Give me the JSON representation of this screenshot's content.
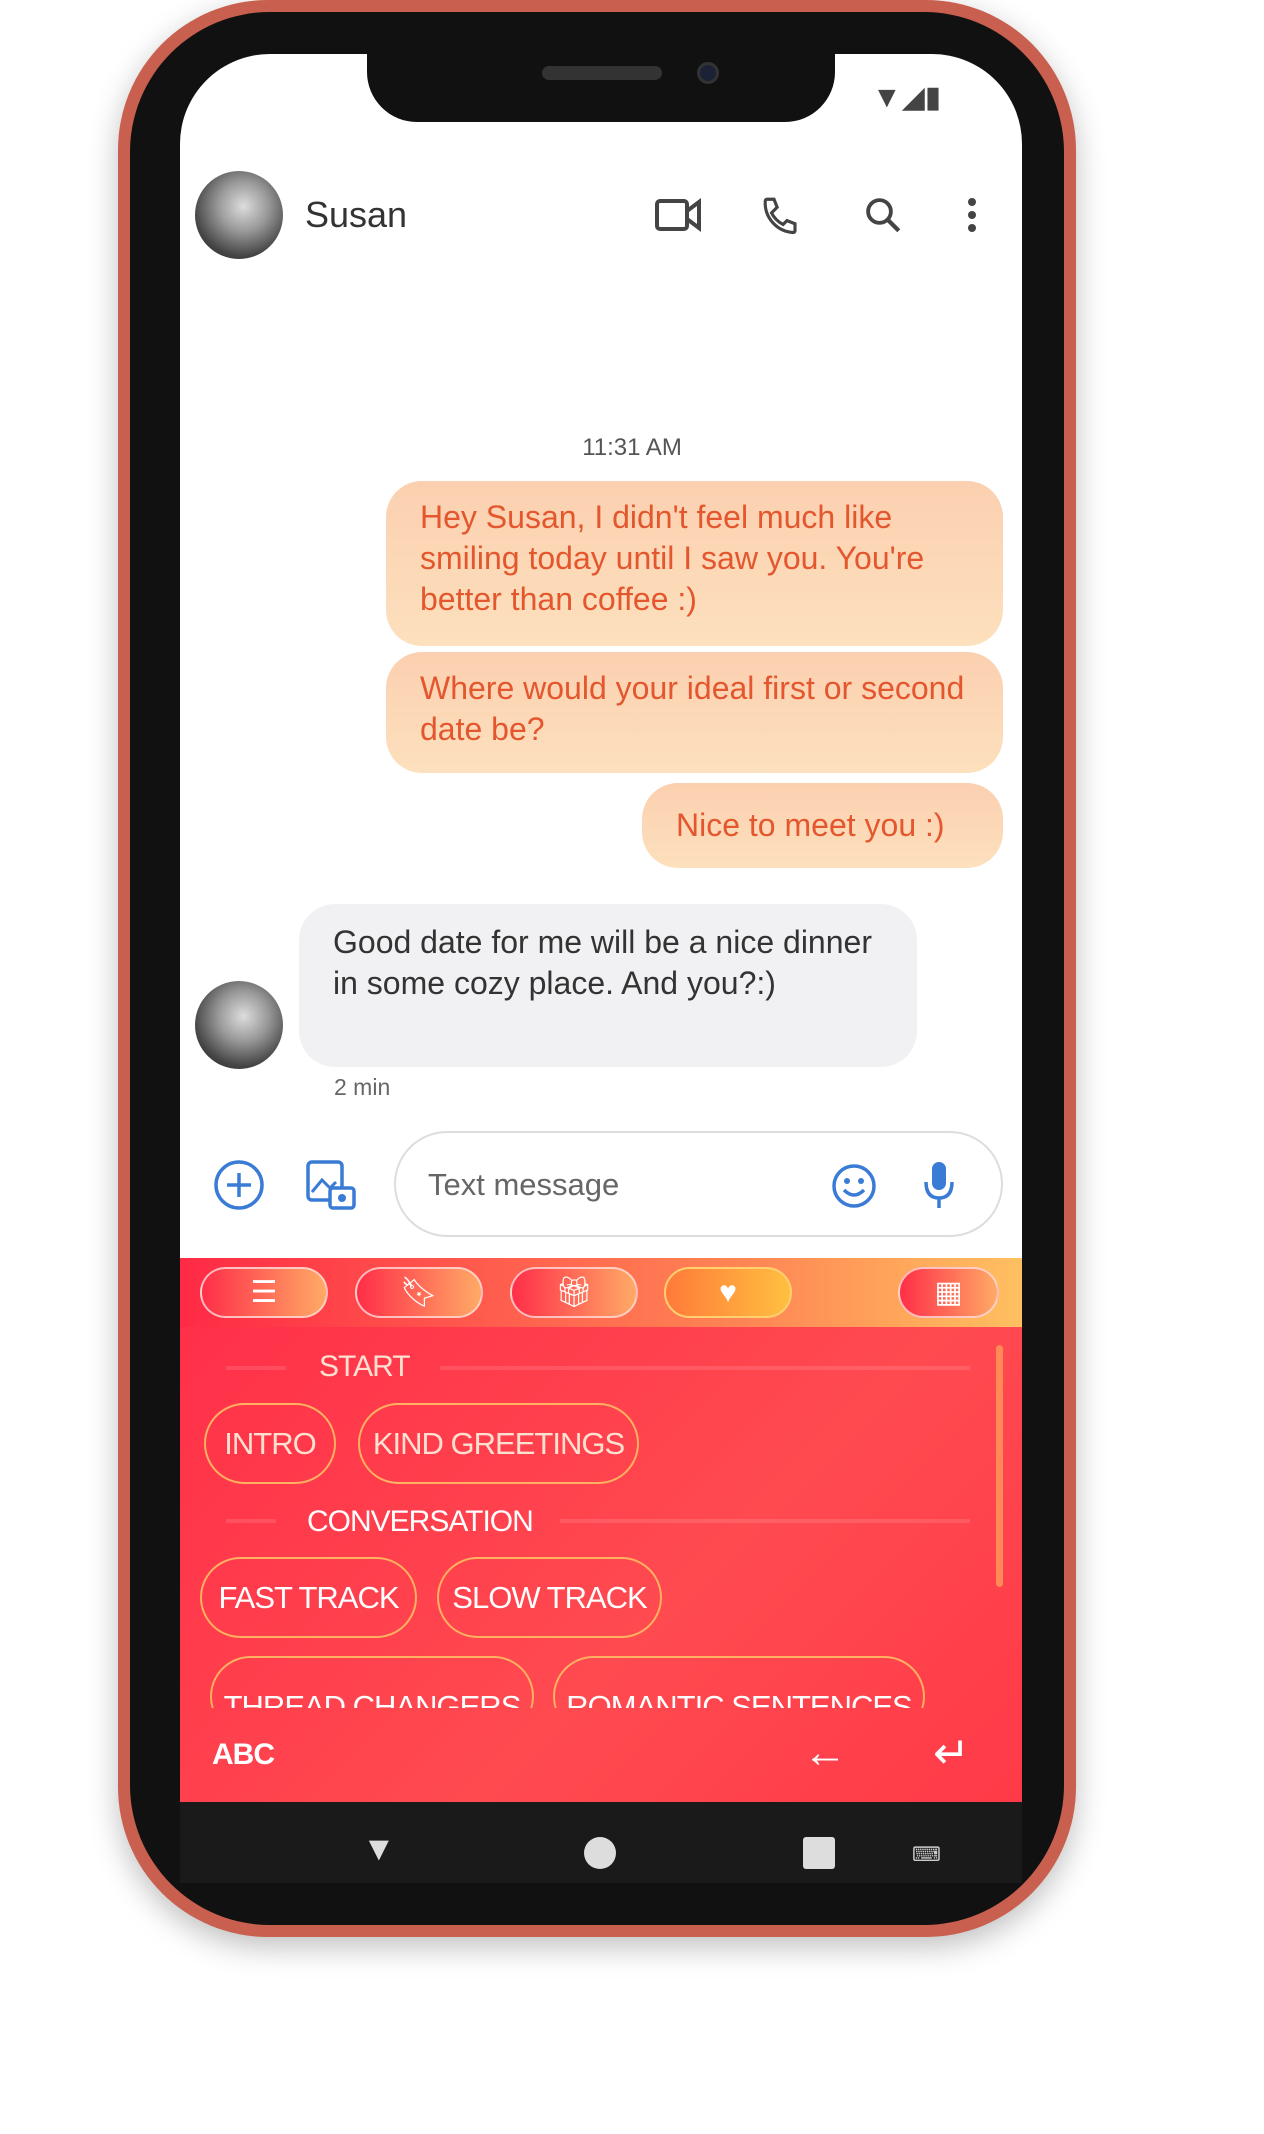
{
  "status_bar": {
    "icons": [
      "wifi-icon",
      "signal-icon",
      "battery-icon"
    ]
  },
  "header": {
    "contact_name": "Susan",
    "actions": [
      "video-call-icon",
      "phone-icon",
      "search-icon",
      "more-vert-icon"
    ]
  },
  "conversation": {
    "timestamp": "11:31 AM",
    "sent": [
      "Hey Susan, I didn't feel much like smiling today until I saw you. You're better than coffee :)",
      "Where would your ideal first or second date be?",
      "Nice to meet you :)"
    ],
    "received": {
      "text": "Good date for me will be a nice dinner in some cozy place. And you?:)",
      "time": "2 min"
    }
  },
  "composer": {
    "placeholder": "Text message"
  },
  "keyboard": {
    "tabs": [
      "list-quotes-icon",
      "bookmark-icon",
      "gift-icon",
      "heart-icon",
      "store-icon"
    ],
    "active_tab": "heart-icon",
    "sections": [
      {
        "title": "START",
        "chips": [
          "INTRO",
          "KIND GREETINGS"
        ]
      },
      {
        "title": "CONVERSATION",
        "chips": [
          "FAST TRACK",
          "SLOW TRACK",
          "THREAD CHANGERS",
          "ROMANTIC SENTENCES"
        ]
      }
    ],
    "abc_label": "ABC",
    "colors": {
      "primary": "#ff3a4c",
      "accent": "#ffb060"
    }
  },
  "nav_bar": {
    "icons": [
      "back-icon",
      "home-icon",
      "recents-icon",
      "keyboard-icon"
    ]
  }
}
